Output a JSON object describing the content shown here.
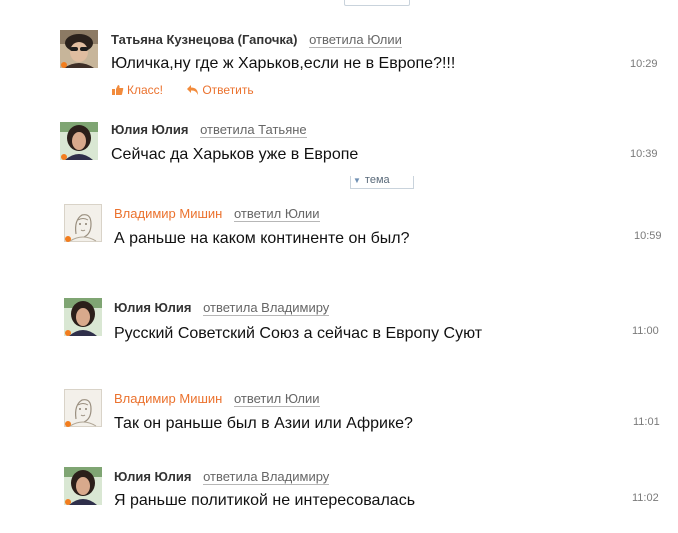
{
  "topic_tag": {
    "label": "тема"
  },
  "actions": {
    "like_label": "Класс!",
    "reply_label": "Ответить"
  },
  "colors": {
    "accent": "#eb722e",
    "online_dot": "#f27d1e",
    "time": "#7a7a7a"
  },
  "messages": [
    {
      "author": "Татьяна Кузнецова (Гапочка)",
      "reply_to": "ответила Юлии",
      "text": "Юличка,ну где ж Харьков,если не в Европе?!!!",
      "time": "10:29"
    },
    {
      "author": "Юлия Юлия",
      "reply_to": "ответила Татьяне",
      "text": "Сейчас да Харьков уже в Европе",
      "time": "10:39"
    },
    {
      "author": "Владимир Мишин",
      "reply_to": "ответил Юлии",
      "text": "А раньше на каком континенте он был?",
      "time": "10:59"
    },
    {
      "author": "Юлия Юлия",
      "reply_to": "ответила Владимиру",
      "text": "Русский Советский Союз а сейчас в Европу Суют",
      "time": "11:00"
    },
    {
      "author": "Владимир Мишин",
      "reply_to": "ответил Юлии",
      "text": "Так он раньше был в Азии или Африке?",
      "time": "11:01"
    },
    {
      "author": "Юлия Юлия",
      "reply_to": "ответила Владимиру",
      "text": "Я раньше политикой не интересовалась",
      "time": "11:02"
    }
  ]
}
